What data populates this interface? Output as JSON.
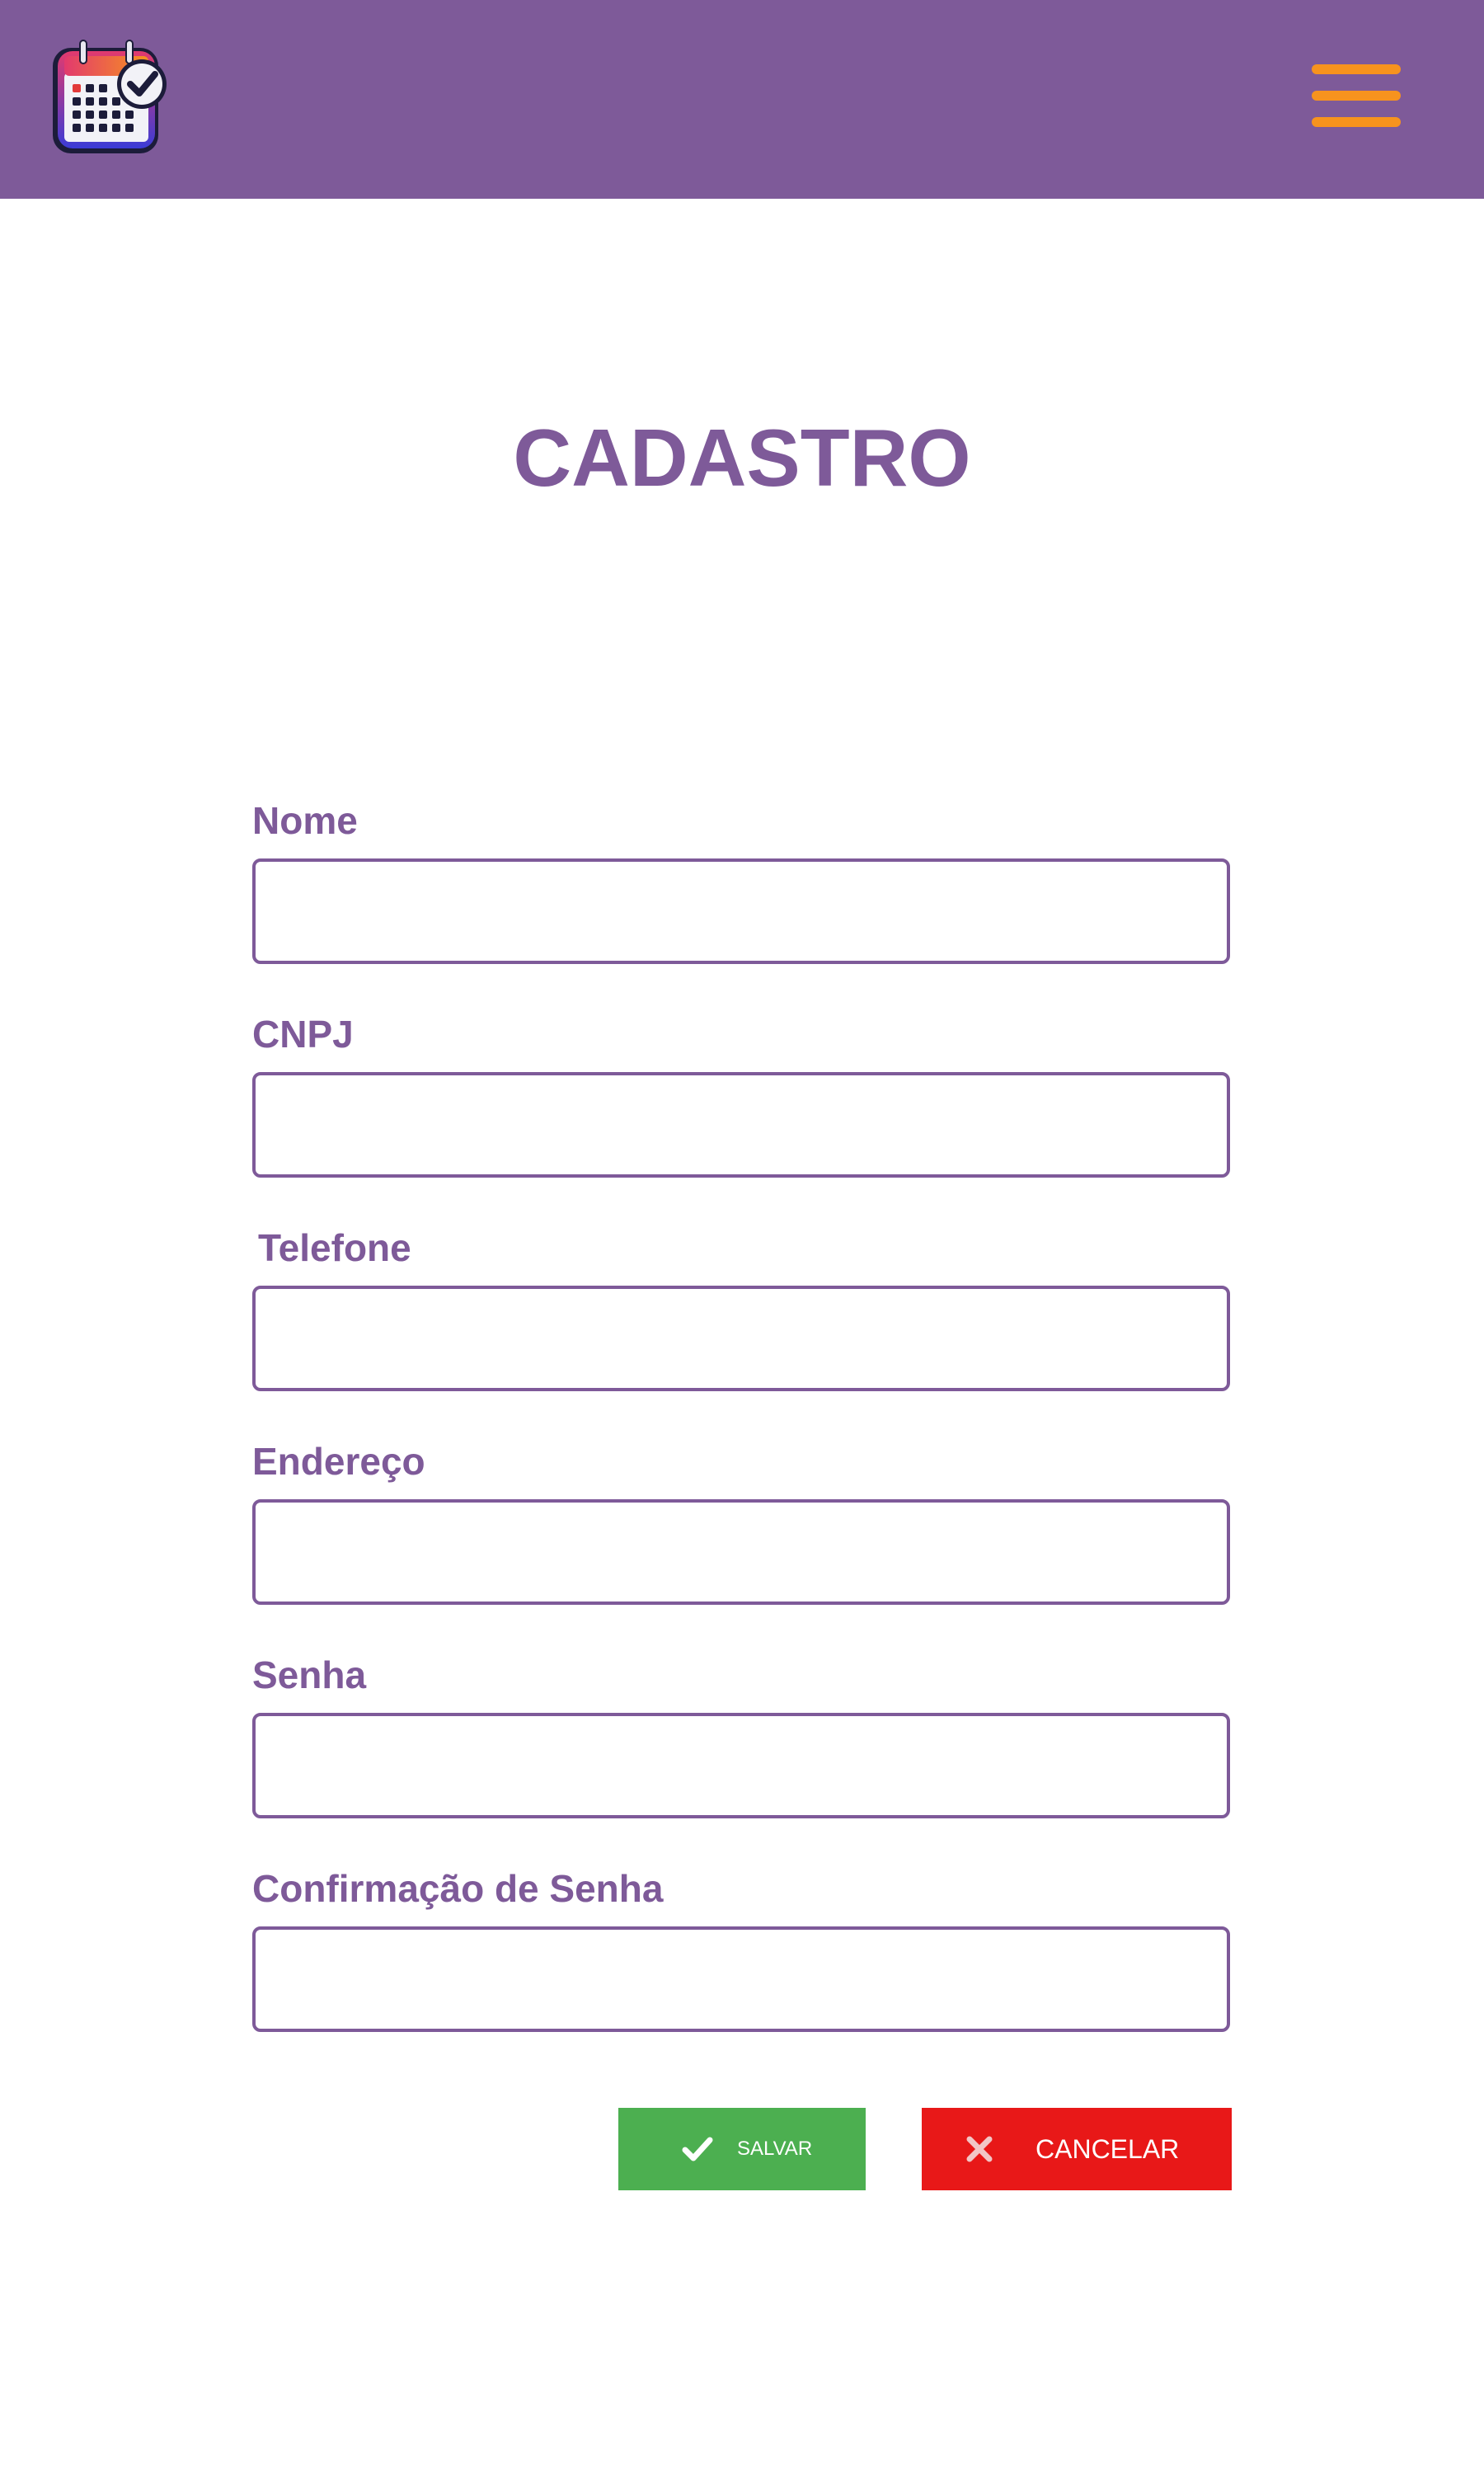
{
  "header": {
    "logo_icon": "calendar-check-icon",
    "menu_icon": "hamburger-menu-icon",
    "background_color": "#7e5a99",
    "menu_color": "#f7931e"
  },
  "page": {
    "title": "CADASTRO"
  },
  "form": {
    "fields": [
      {
        "label": "Nome",
        "value": ""
      },
      {
        "label": "CNPJ",
        "value": ""
      },
      {
        "label": "Telefone",
        "value": ""
      },
      {
        "label": "Endereço",
        "value": ""
      },
      {
        "label": "Senha",
        "value": ""
      },
      {
        "label": "Confirmação de Senha",
        "value": ""
      }
    ],
    "accent_color": "#7e5a99"
  },
  "actions": {
    "save": {
      "label": "SALVAR",
      "icon": "check-icon",
      "color": "#4caf50"
    },
    "cancel": {
      "label": "CANCELAR",
      "icon": "close-icon",
      "color": "#e81818"
    }
  }
}
